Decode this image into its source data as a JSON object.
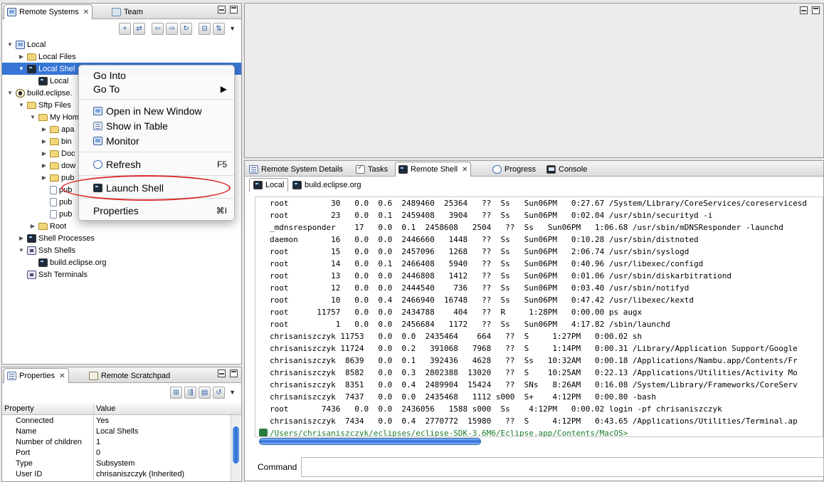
{
  "remote_systems": {
    "tabs": [
      {
        "label": "Remote Systems",
        "icon": "monitor-icon"
      },
      {
        "label": "Team",
        "icon": "team-icon"
      }
    ],
    "tree": [
      {
        "label": "Local",
        "indent": 0,
        "twisty": "open",
        "icon": "monitor-icon"
      },
      {
        "label": "Local Files",
        "indent": 1,
        "twisty": "closed",
        "icon": "folder-icon"
      },
      {
        "label": "Local Shel",
        "indent": 1,
        "twisty": "open",
        "icon": "shell-icon",
        "selected": true
      },
      {
        "label": "Local",
        "indent": 2,
        "twisty": "",
        "icon": "shell-icon"
      },
      {
        "label": "build.eclipse.",
        "indent": 0,
        "twisty": "open",
        "icon": "host-icon"
      },
      {
        "label": "Sftp Files",
        "indent": 1,
        "twisty": "open",
        "icon": "folder-icon"
      },
      {
        "label": "My Hom",
        "indent": 2,
        "twisty": "open",
        "icon": "folder-icon"
      },
      {
        "label": "apa",
        "indent": 3,
        "twisty": "closed",
        "icon": "folder-icon"
      },
      {
        "label": "bin",
        "indent": 3,
        "twisty": "closed",
        "icon": "folder-icon"
      },
      {
        "label": "Doc",
        "indent": 3,
        "twisty": "closed",
        "icon": "folder-icon"
      },
      {
        "label": "dow",
        "indent": 3,
        "twisty": "closed",
        "icon": "folder-icon"
      },
      {
        "label": "pub",
        "indent": 3,
        "twisty": "closed",
        "icon": "folder-icon"
      },
      {
        "label": "pub",
        "indent": 3,
        "twisty": "",
        "icon": "file-icon"
      },
      {
        "label": "pub",
        "indent": 3,
        "twisty": "",
        "icon": "file-icon"
      },
      {
        "label": "pub",
        "indent": 3,
        "twisty": "",
        "icon": "file-icon"
      },
      {
        "label": "Root",
        "indent": 2,
        "twisty": "closed",
        "icon": "folder-icon"
      },
      {
        "label": "Shell Processes",
        "indent": 1,
        "twisty": "closed",
        "icon": "shell-icon"
      },
      {
        "label": "Ssh Shells",
        "indent": 1,
        "twisty": "open",
        "icon": "ssh-icon"
      },
      {
        "label": "build.eclipse.org",
        "indent": 2,
        "twisty": "",
        "icon": "shell-icon"
      },
      {
        "label": "Ssh Terminals",
        "indent": 1,
        "twisty": "",
        "icon": "ssh-icon"
      }
    ]
  },
  "context_menu": {
    "go_into": "Go Into",
    "go_to": "Go To",
    "open_new_window": "Open in New Window",
    "show_in_table": "Show in Table",
    "monitor": "Monitor",
    "refresh": "Refresh",
    "refresh_shortcut": "F5",
    "launch_shell": "Launch Shell",
    "properties": "Properties",
    "properties_shortcut": "⌘I",
    "highlight_color": "#d92b2b"
  },
  "properties_view": {
    "tabs": [
      {
        "label": "Properties",
        "icon": "properties-icon"
      },
      {
        "label": "Remote Scratchpad",
        "icon": "scratchpad-icon"
      }
    ],
    "header": {
      "property": "Property",
      "value": "Value"
    },
    "rows": [
      {
        "property": "Connected",
        "value": "Yes"
      },
      {
        "property": "Name",
        "value": "Local Shells"
      },
      {
        "property": "Number of children",
        "value": "1"
      },
      {
        "property": "Port",
        "value": "0"
      },
      {
        "property": "Type",
        "value": "Subsystem"
      },
      {
        "property": "User ID",
        "value": "chrisaniszczyk (Inherited)"
      }
    ]
  },
  "bottom_view": {
    "tabs": [
      {
        "label": "Remote System Details",
        "icon": "details-icon"
      },
      {
        "label": "Tasks",
        "icon": "tasks-icon"
      },
      {
        "label": "Remote Shell",
        "icon": "shell-icon",
        "active": true
      },
      {
        "label": "Progress",
        "icon": "progress-icon"
      },
      {
        "label": "Console",
        "icon": "console-icon"
      }
    ],
    "shell_tabs": [
      {
        "label": "Local",
        "active": true
      },
      {
        "label": "build.eclipse.org",
        "active": false
      }
    ],
    "output_lines": [
      "root         30   0.0  0.6  2489460  25364   ??  Ss   Sun06PM   0:27.67 /System/Library/CoreServices/coreservicesd",
      "root         23   0.0  0.1  2459408   3904   ??  Ss   Sun06PM   0:02.04 /usr/sbin/securityd -i",
      "_mdnsresponder    17   0.0  0.1  2458608   2504   ??  Ss   Sun06PM   1:06.68 /usr/sbin/mDNSResponder -launchd",
      "daemon       16   0.0  0.0  2446660   1448   ??  Ss   Sun06PM   0:10.28 /usr/sbin/distnoted",
      "root         15   0.0  0.0  2457096   1268   ??  Ss   Sun06PM   2:06.74 /usr/sbin/syslogd",
      "root         14   0.0  0.1  2466408   5940   ??  Ss   Sun06PM   0:40.96 /usr/libexec/configd",
      "root         13   0.0  0.0  2446808   1412   ??  Ss   Sun06PM   0:01.06 /usr/sbin/diskarbitrationd",
      "root         12   0.0  0.0  2444540    736   ??  Ss   Sun06PM   0:03.40 /usr/sbin/notifyd",
      "root         10   0.0  0.4  2466940  16748   ??  Ss   Sun06PM   0:47.42 /usr/libexec/kextd",
      "root      11757   0.0  0.0  2434788    404   ??  R     1:28PM   0:00.00 ps augx",
      "root          1   0.0  0.0  2456684   1172   ??  Ss   Sun06PM   4:17.82 /sbin/launchd",
      "chrisaniszczyk 11753   0.0  0.0  2435464    664   ??  S     1:27PM   0:00.02 sh",
      "chrisaniszczyk 11724   0.0  0.2   391068   7968   ??  S     1:14PM   0:00.31 /Library/Application Support/Google",
      "chrisaniszczyk  8639   0.0  0.1   392436   4628   ??  Ss   10:32AM   0:00.18 /Applications/Nambu.app/Contents/Fr",
      "chrisaniszczyk  8582   0.0  0.3  2802388  13020   ??  S    10:25AM   0:22.13 /Applications/Utilities/Activity Mo",
      "chrisaniszczyk  8351   0.0  0.4  2489904  15424   ??  SNs   8:26AM   0:16.08 /System/Library/Frameworks/CoreServ",
      "chrisaniszczyk  7437   0.0  0.0  2435468   1112 s000  S+    4:12PM   0:00.80 -bash",
      "root       7436   0.0  0.0  2436056   1588 s000  Ss    4:12PM   0:00.02 login -pf chrisaniszczyk",
      "chrisaniszczyk  7434   0.0  0.4  2770772  15980   ??  S     4:12PM   0:43.65 /Applications/Utilities/Terminal.ap"
    ],
    "prompt_path": "/Users/chrisaniszczyk/eclipses/eclipse-SDK-3.6M6/Eclipse.app/Contents/MacOS>",
    "command_label": "Command",
    "command_value": ""
  }
}
